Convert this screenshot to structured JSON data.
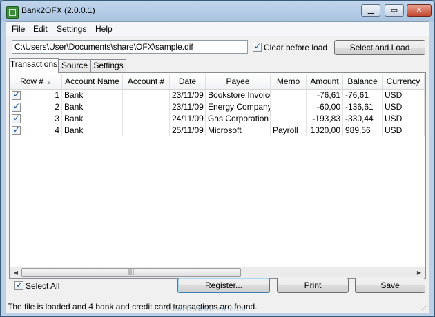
{
  "window": {
    "title": "Bank2OFX (2.0.0.1)"
  },
  "menu": [
    "File",
    "Edit",
    "Settings",
    "Help"
  ],
  "file_path": "C:\\Users\\User\\Documents\\share\\OFX\\sample.qif",
  "clear_before_load": {
    "label": "Clear before load",
    "checked": true
  },
  "select_load_label": "Select and Load",
  "tabs": [
    "Transactions",
    "Source",
    "Settings"
  ],
  "active_tab": "Transactions",
  "columns": [
    "Row #",
    "Account Name",
    "Account #",
    "Date",
    "Payee",
    "Memo",
    "Amount",
    "Balance",
    "Currency"
  ],
  "rows": [
    {
      "checked": true,
      "row": "1",
      "account_name": "Bank",
      "account_no": "",
      "date": "23/11/09",
      "payee": "Bookstore Invoice",
      "memo": "",
      "amount": "-76,61",
      "balance": "-76,61",
      "currency": "USD"
    },
    {
      "checked": true,
      "row": "2",
      "account_name": "Bank",
      "account_no": "",
      "date": "23/11/09",
      "payee": "Energy Company",
      "memo": "",
      "amount": "-60,00",
      "balance": "-136,61",
      "currency": "USD"
    },
    {
      "checked": true,
      "row": "3",
      "account_name": "Bank",
      "account_no": "",
      "date": "24/11/09",
      "payee": "Gas Corporation",
      "memo": "",
      "amount": "-193,83",
      "balance": "-330,44",
      "currency": "USD"
    },
    {
      "checked": true,
      "row": "4",
      "account_name": "Bank",
      "account_no": "",
      "date": "25/11/09",
      "payee": "Microsoft",
      "memo": "Payroll",
      "amount": "1320,00",
      "balance": "989,56",
      "currency": "USD"
    }
  ],
  "select_all": {
    "label": "Select All",
    "checked": true
  },
  "buttons": {
    "register": "Register...",
    "print": "Print",
    "save": "Save"
  },
  "status": "The file is loaded and 4 bank and credit card transactions are found.",
  "watermark": "GearDownload.com",
  "icons": {
    "check": "✓",
    "sort": "sort-ascending-icon",
    "minimize": "minimize-icon",
    "maximize": "maximize-icon",
    "close": "close-icon"
  }
}
